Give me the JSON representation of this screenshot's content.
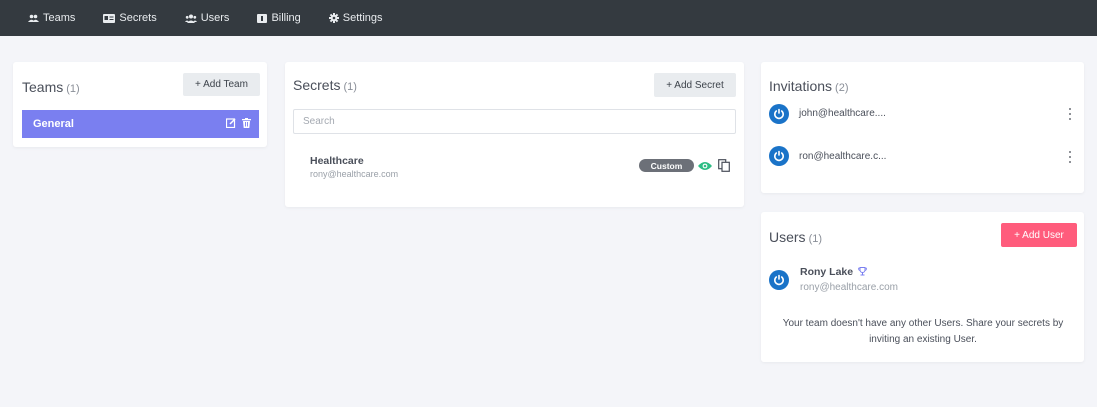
{
  "nav": {
    "teams": "Teams",
    "secrets": "Secrets",
    "users": "Users",
    "billing": "Billing",
    "settings": "Settings"
  },
  "teams_panel": {
    "title": "Teams",
    "count": "(1)",
    "add_label": "+ Add Team",
    "items": [
      {
        "name": "General"
      }
    ]
  },
  "secrets_panel": {
    "title": "Secrets",
    "count": "(1)",
    "add_label": "+ Add Secret",
    "search_placeholder": "Search",
    "items": [
      {
        "name": "Healthcare",
        "email": "rony@healthcare.com",
        "badge": "Custom"
      }
    ]
  },
  "invitations_panel": {
    "title": "Invitations",
    "count": "(2)",
    "items": [
      {
        "email": "john@healthcare...."
      },
      {
        "email": "ron@healthcare.c..."
      }
    ]
  },
  "users_panel": {
    "title": "Users",
    "count": "(1)",
    "add_label": "+ Add User",
    "items": [
      {
        "name": "Rony Lake",
        "email": "rony@healthcare.com"
      }
    ],
    "note": "Your team doesn't have any other Users. Share your secrets by inviting an existing User."
  },
  "colors": {
    "topbar": "#343a40",
    "active_team": "#7a7ff0",
    "add_user": "#ff5c7c",
    "avatar": "#1a73c8",
    "eye": "#2ebd85"
  }
}
